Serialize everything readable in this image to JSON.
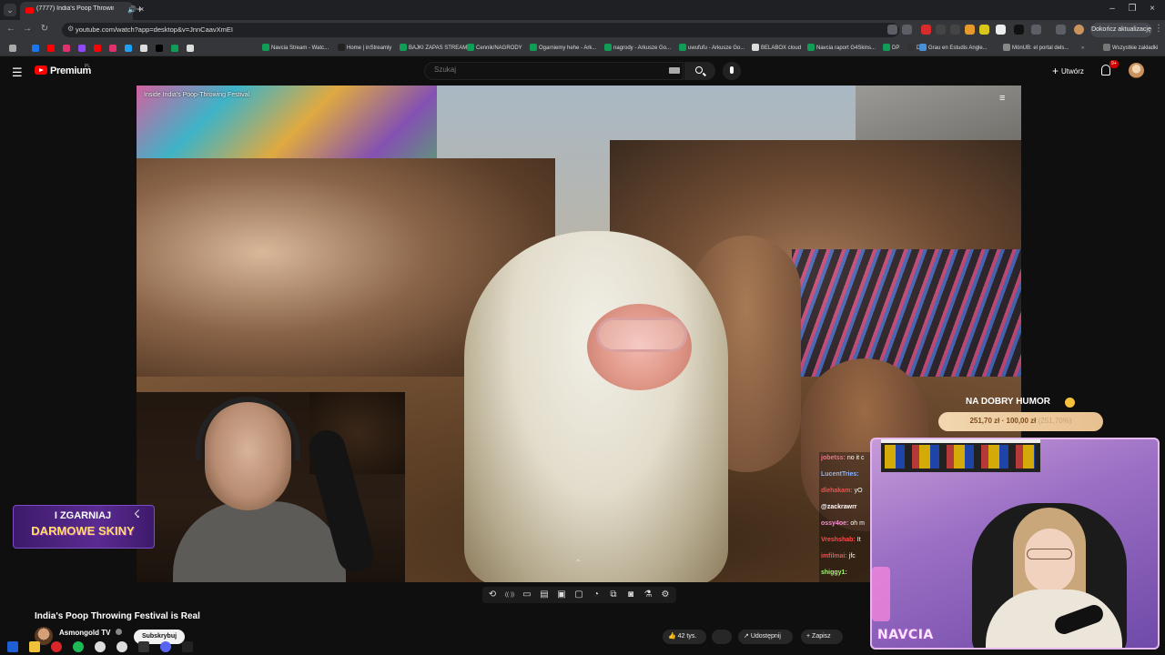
{
  "browser": {
    "tab_menu_icon": "chevron-down-icon",
    "active_tab": {
      "title": "(7777) India's Poop Throwing",
      "mute_icon": "speaker-icon",
      "close_icon": "close-icon"
    },
    "new_tab_icon": "plus-icon",
    "window_controls": [
      "minimize-icon",
      "restore-icon",
      "close-icon"
    ],
    "url": "youtube.com/watch?app=desktop&v=JnnCaavXmEI",
    "update_button": "Dokończ aktualizację",
    "bookmarks": [
      "Navcia Stream - Watc...",
      "Home | inStreamly",
      "BAJKI ZAPAS STREAM",
      "Cennik/NAGRODY",
      "Ogarniemy hehe - Ark...",
      "nagrody - Arkusze Go...",
      "uwufufu - Arkusze Go...",
      "BELABOX cloud",
      "Navcia raport G4Skins...",
      "DP",
      "D",
      "Grau en Estudis Angle...",
      "MónUB: el portal dels..."
    ],
    "all_bookmarks": "Wszystkie zakładki",
    "bookmark_colors": [
      "#1877f2",
      "#ff0000",
      "#e1306c",
      "#9146ff",
      "#ff0000",
      "#e1306c",
      "#1da1f2",
      "#dddddd",
      "#010101",
      "#0f9d58",
      "#dddddd"
    ]
  },
  "youtube": {
    "brand": "Premium",
    "region": "PL",
    "search_placeholder": "Szukaj",
    "create_label": "Utwórz",
    "notification_count": "9+",
    "accent": "#ff0000"
  },
  "video": {
    "overlay_title": "Inside India's Poop-Throwing Festival",
    "title": "India's Poop Throwing Festival is Real",
    "channel": "Asmongold TV",
    "subscribe_label": "Subskrybuj",
    "actions": [
      "42 tys.",
      "",
      "Udostępnij",
      "Zapisz"
    ]
  },
  "chat": [
    {
      "user": "jobetss:",
      "msg": "no it c",
      "color": "#ff6b8a"
    },
    {
      "user": "LucentTries:",
      "msg": "",
      "color": "#8ab4ff"
    },
    {
      "user": "dlehakam:",
      "msg": "yO",
      "color": "#ff4a4a"
    },
    {
      "user": "@zackrawrr",
      "msg": "",
      "color": "#ffffff"
    },
    {
      "user": "ossy4oe:",
      "msg": "oh m",
      "color": "#ff8ad8"
    },
    {
      "user": "Vreshshab:",
      "msg": "It",
      "color": "#ff4a4a"
    },
    {
      "user": "imfilmai:",
      "msg": "jfc",
      "color": "#ff4a4a"
    },
    {
      "user": "shiggy1:",
      "msg": "",
      "color": "#9cff6b"
    }
  ],
  "promo": {
    "line1": "I ZGARNIAJ",
    "line2": "DARMOWE SKINY"
  },
  "alert": {
    "title": "NA DOBRY HUMOR",
    "amount": "251,70 zł ",
    "sep": "·",
    "goal": " 100,00 zł ",
    "pct": "(251,70%)"
  },
  "streamer_name": "NAVCIA",
  "controls": [
    "loop-icon",
    "broadcast-icon",
    "screen-icon",
    "subtitles-icon",
    "crop-icon",
    "window-icon",
    "speed-icon",
    "pip-icon",
    "camera-icon",
    "lab-icon",
    "gear-icon"
  ]
}
